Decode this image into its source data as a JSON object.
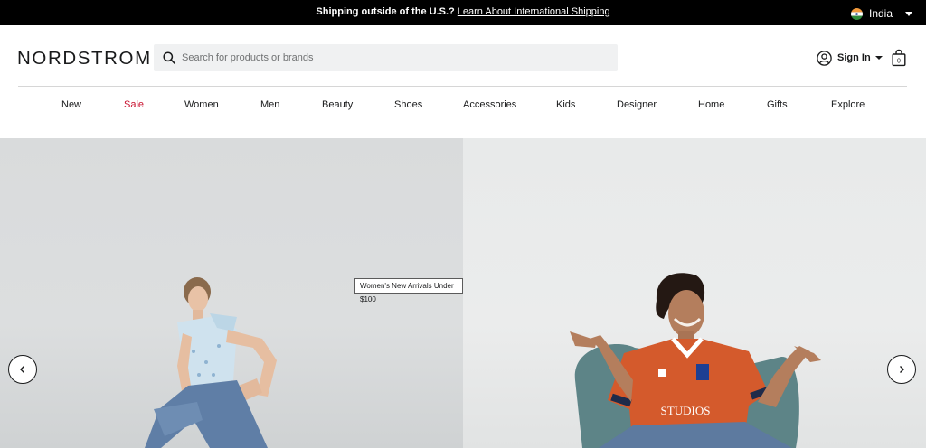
{
  "banner": {
    "message_bold": "Shipping outside of the U.S.?",
    "link_text": "Learn About International Shipping",
    "country": "India"
  },
  "header": {
    "logo": "NORDSTROM",
    "search_placeholder": "Search for products or brands",
    "sign_in": "Sign In"
  },
  "nav": {
    "items": [
      "New",
      "Sale",
      "Women",
      "Men",
      "Beauty",
      "Shoes",
      "Accessories",
      "Kids",
      "Designer",
      "Home",
      "Gifts",
      "Explore"
    ]
  },
  "hero": {
    "tooltip": "Women's New Arrivals Under $100",
    "jersey_text": "STUDIOS"
  },
  "colors": {
    "sale": "#c8102e",
    "banner_bg": "#000000",
    "text": "#191a1b"
  }
}
